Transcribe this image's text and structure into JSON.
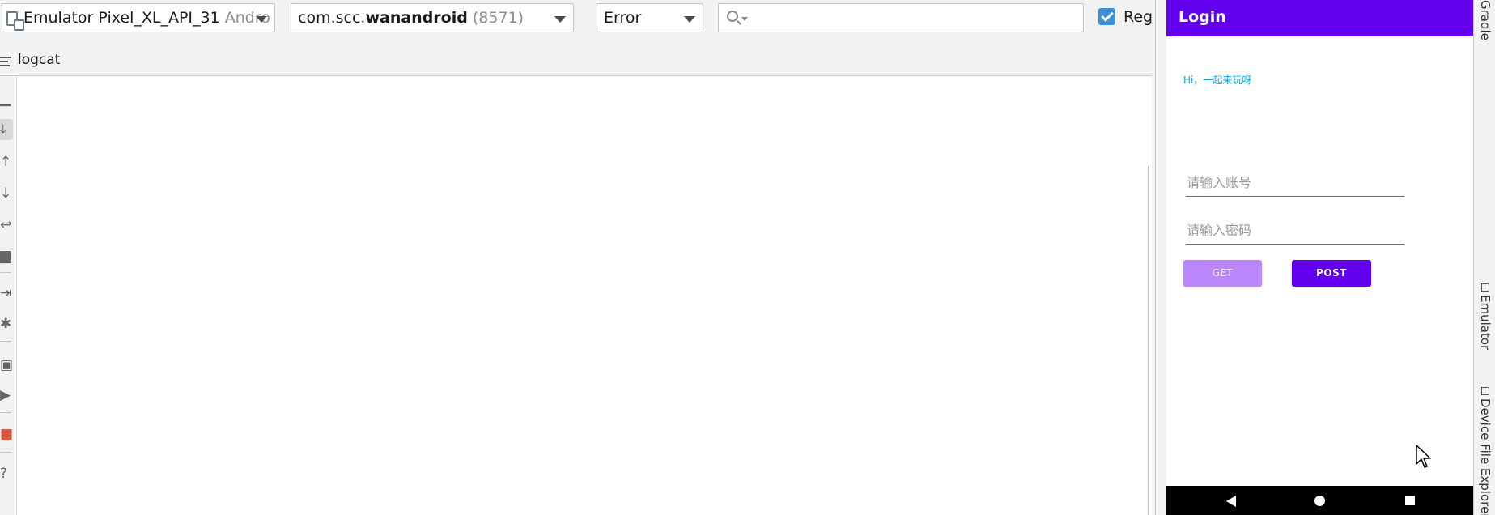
{
  "logcat": {
    "device_combo": {
      "name": "Emulator Pixel_XL_API_31",
      "suffix": "Andro"
    },
    "process_combo": {
      "prefix": "com.scc.",
      "bold": "wanandroid",
      "pid": "(8571)"
    },
    "level_combo": {
      "value": "Error"
    },
    "search": {
      "placeholder": "",
      "value": ""
    },
    "regex": {
      "label": "Reg",
      "checked": true
    },
    "tab_label": "logcat",
    "sidebar_icons": [
      "trash-icon",
      "scroll-to-end-icon",
      "up-icon",
      "down-icon",
      "soft-wrap-icon",
      "print-icon",
      "restart-icon",
      "settings-icon",
      "screenshot-icon",
      "screen-record-icon",
      "stop-icon",
      "help-icon"
    ]
  },
  "emulator": {
    "title": "Login",
    "greeting": "Hi，一起来玩呀",
    "account_placeholder": "请输入账号",
    "password_placeholder": "请输入密码",
    "get_label": "GET",
    "post_label": "POST",
    "colors": {
      "primary": "#6200ee",
      "primary_light": "#bb86fc",
      "accent_text": "#03a9f4"
    }
  },
  "right_strip": {
    "tabs": [
      "Gradle",
      "Emulator",
      "Device File Explorer"
    ]
  }
}
